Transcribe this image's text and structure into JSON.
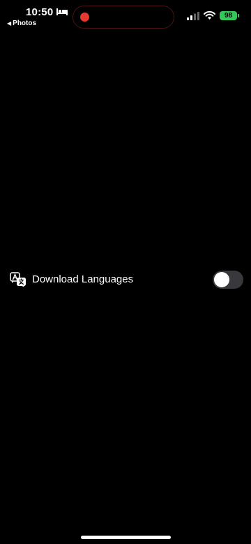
{
  "status_bar": {
    "time": "10:50",
    "back_label": "Photos",
    "battery": "98",
    "battery_color": "#34c759",
    "recording_color": "#e5392f"
  },
  "settings": {
    "download_languages": {
      "label": "Download Languages",
      "icon": "translate-icon",
      "enabled": false
    }
  }
}
